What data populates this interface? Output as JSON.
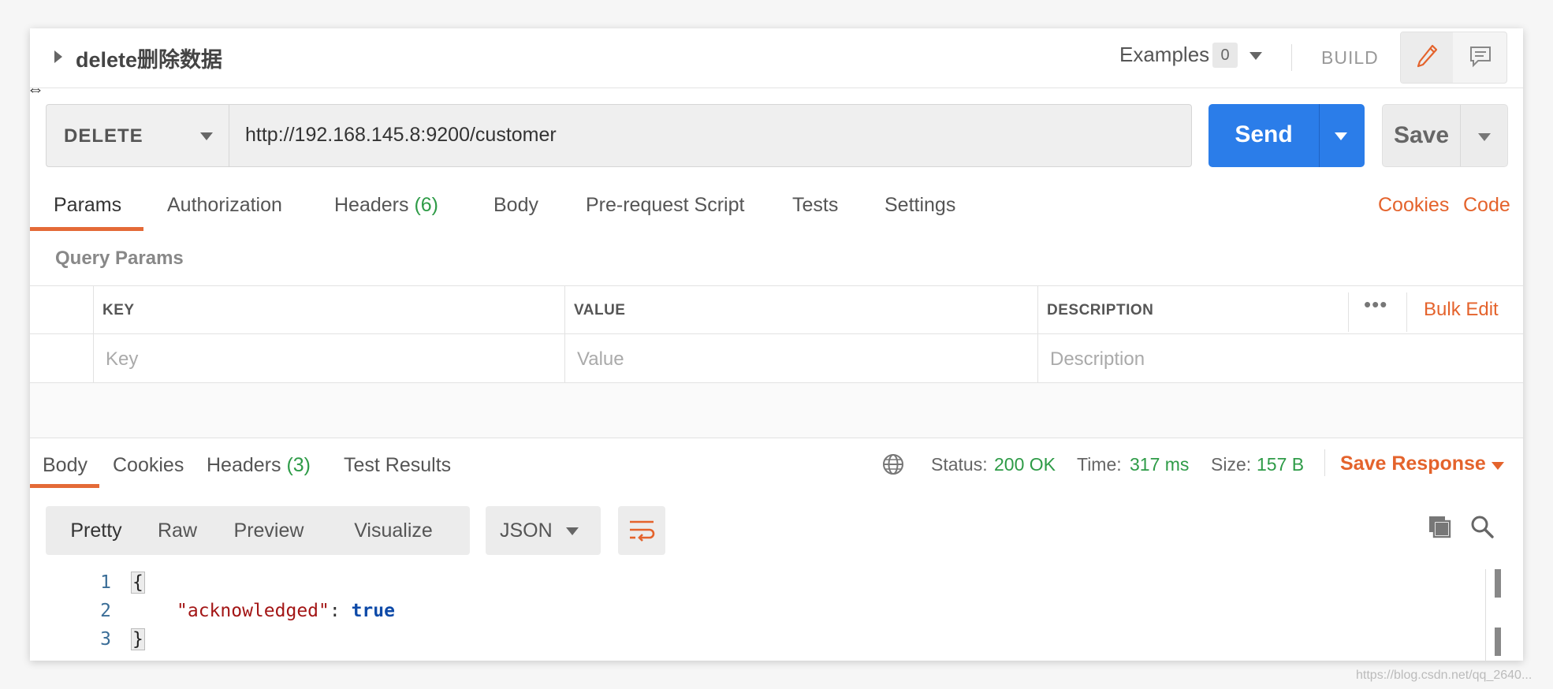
{
  "request": {
    "title": "delete删除数据",
    "examples_label": "Examples",
    "examples_count": "0",
    "build_label": "BUILD",
    "method": "DELETE",
    "url": "http://192.168.145.8:9200/customer",
    "send_label": "Send",
    "save_label": "Save"
  },
  "request_tabs": [
    {
      "label": "Params",
      "count": ""
    },
    {
      "label": "Authorization",
      "count": ""
    },
    {
      "label": "Headers",
      "count": "(6)"
    },
    {
      "label": "Body",
      "count": ""
    },
    {
      "label": "Pre-request Script",
      "count": ""
    },
    {
      "label": "Tests",
      "count": ""
    },
    {
      "label": "Settings",
      "count": ""
    }
  ],
  "links": {
    "cookies": "Cookies",
    "code": "Code"
  },
  "query_params": {
    "label": "Query Params",
    "headers": [
      "KEY",
      "VALUE",
      "DESCRIPTION"
    ],
    "placeholders": [
      "Key",
      "Value",
      "Description"
    ],
    "bulk_edit": "Bulk Edit",
    "more": "•••"
  },
  "response_tabs": [
    {
      "label": "Body",
      "count": ""
    },
    {
      "label": "Cookies",
      "count": ""
    },
    {
      "label": "Headers",
      "count": "(3)"
    },
    {
      "label": "Test Results",
      "count": ""
    }
  ],
  "status": {
    "status_label": "Status:",
    "status_value": "200 OK",
    "time_label": "Time:",
    "time_value": "317 ms",
    "size_label": "Size:",
    "size_value": "157 B",
    "save_response": "Save Response"
  },
  "format": {
    "modes": [
      "Pretty",
      "Raw",
      "Preview",
      "Visualize"
    ],
    "active_mode": "Pretty",
    "language": "JSON"
  },
  "code": {
    "line_numbers": [
      "1",
      "2",
      "3"
    ],
    "open_brace": "{",
    "key": "\"acknowledged\"",
    "colon": ": ",
    "value": "true",
    "close_brace": "}"
  },
  "colors": {
    "accent": "#e4632c",
    "send": "#2b7de9",
    "ok": "#2e9b47"
  },
  "watermark": "https://blog.csdn.net/qq_2640..."
}
